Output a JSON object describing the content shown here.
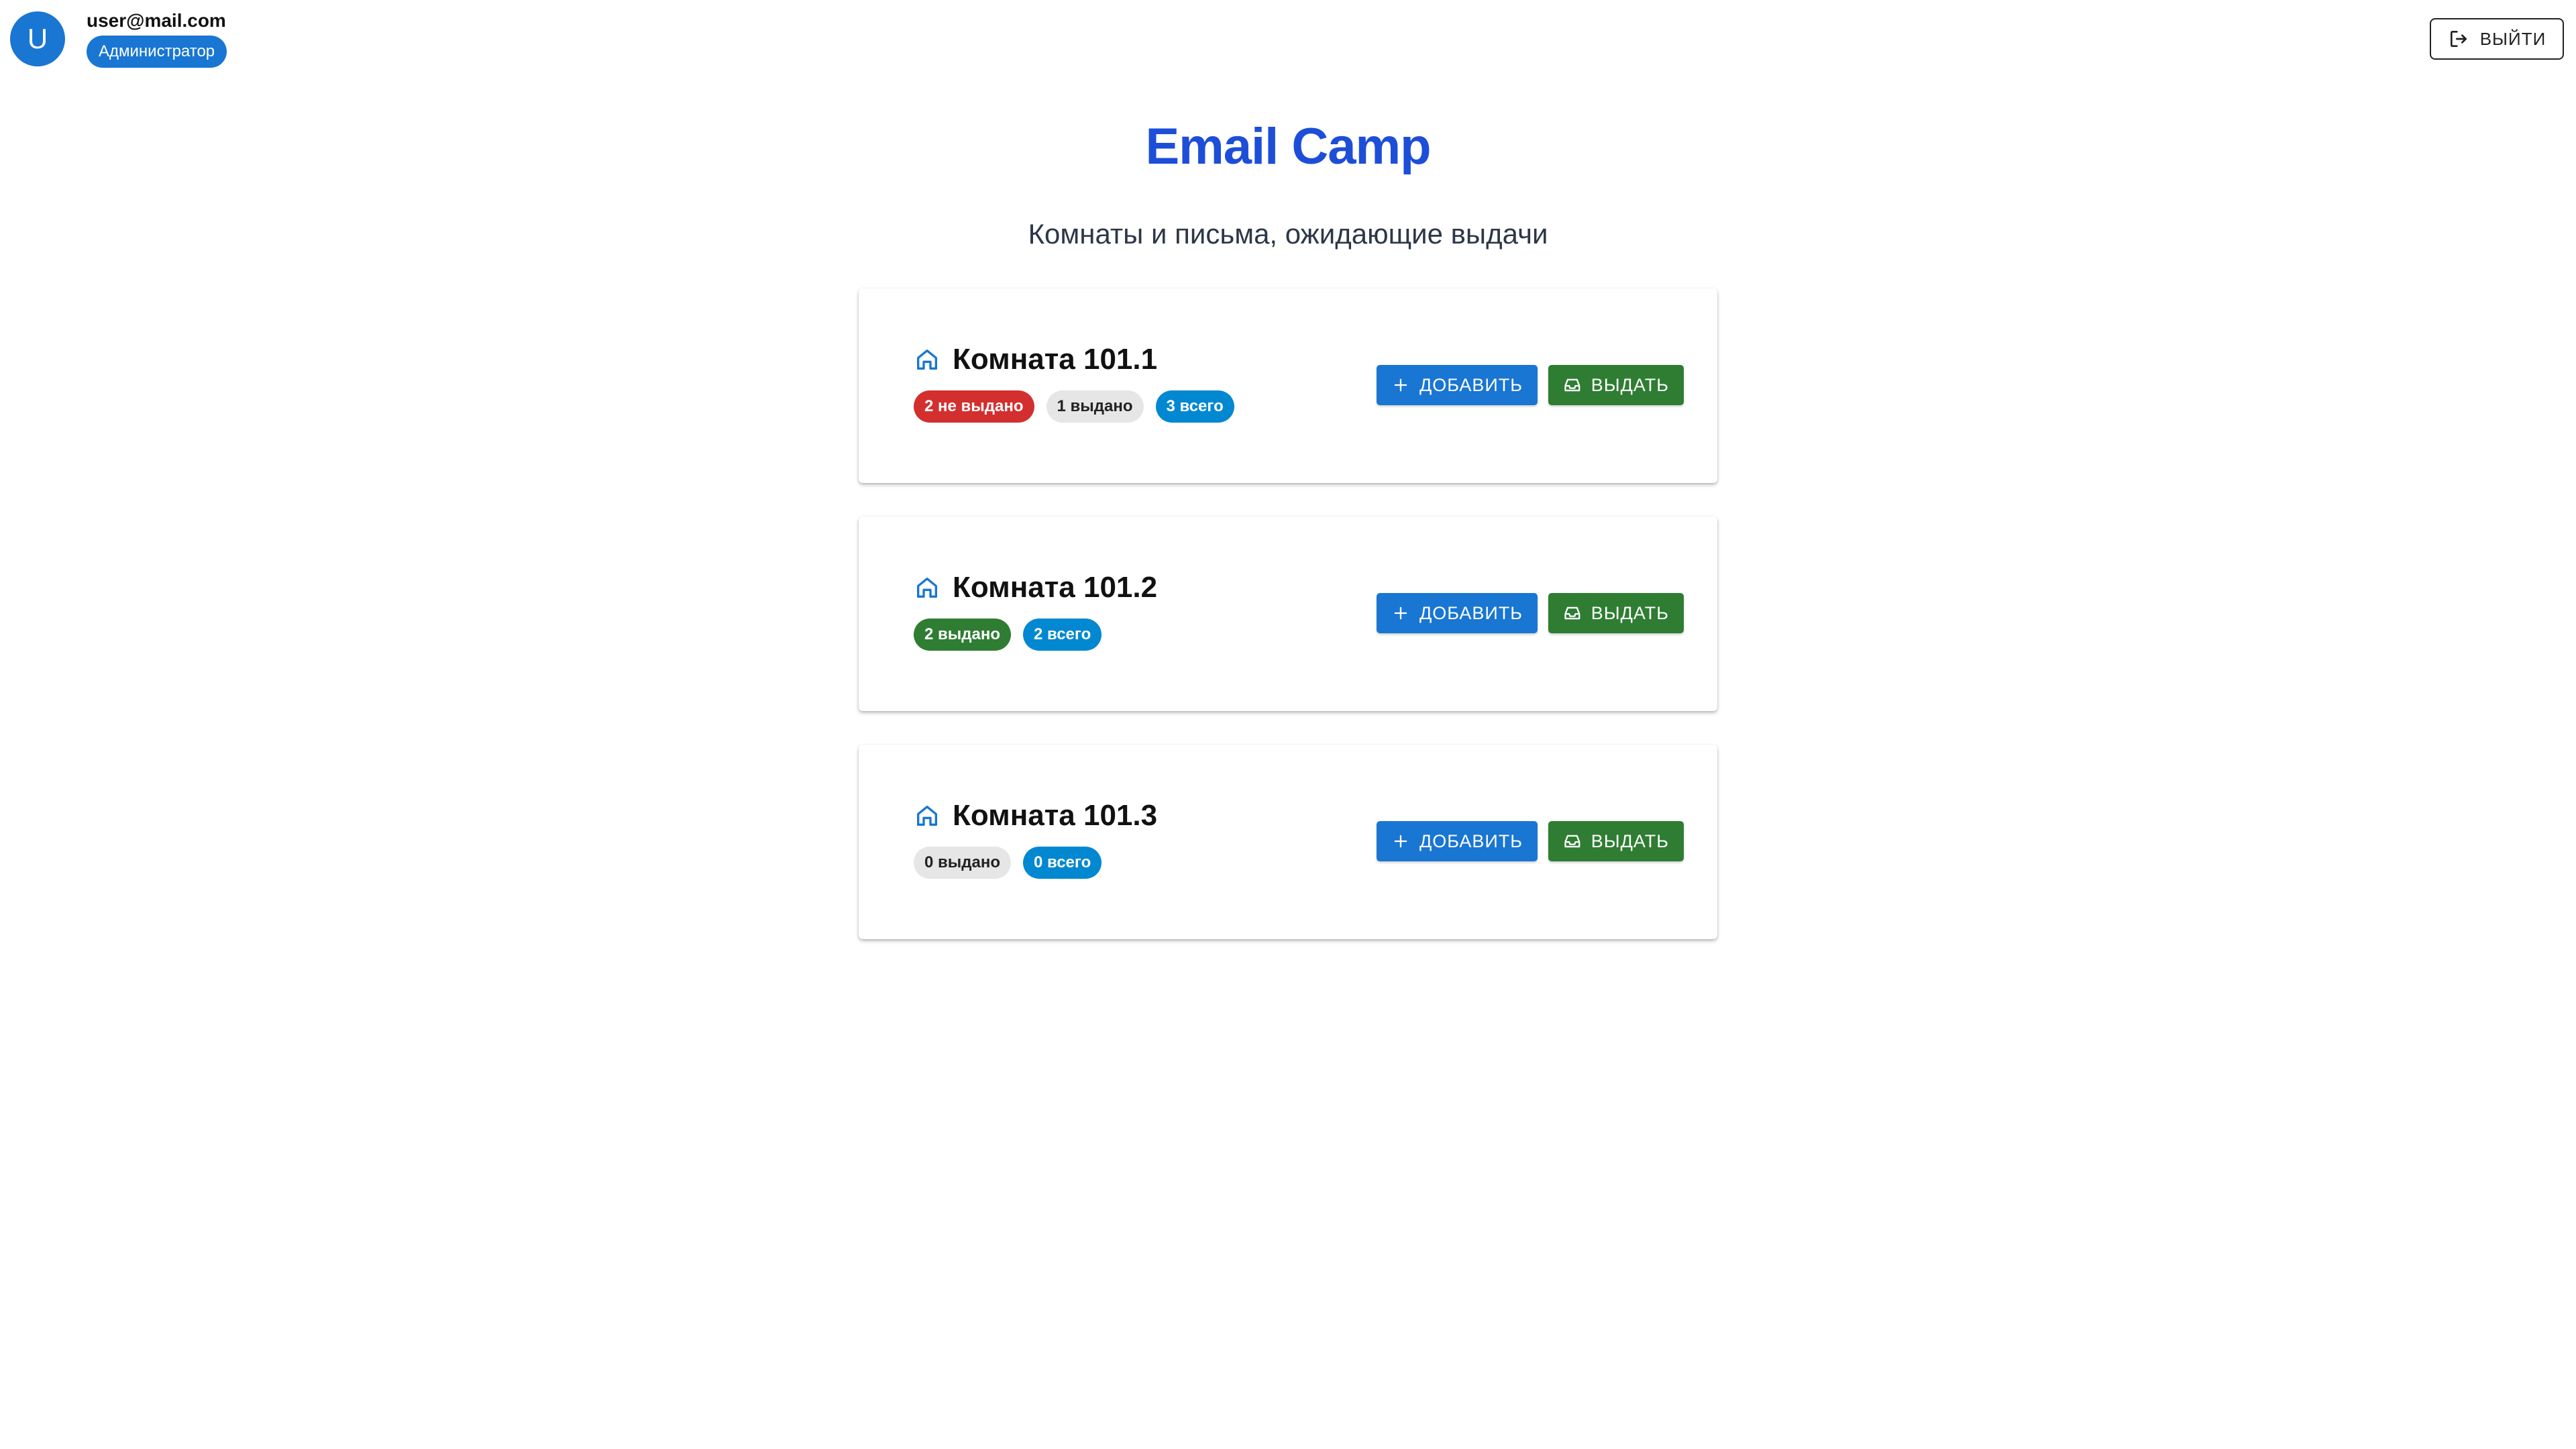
{
  "user": {
    "avatar_letter": "U",
    "email": "user@mail.com",
    "role": "Администратор"
  },
  "header": {
    "logout_label": "ВЫЙТИ"
  },
  "main": {
    "title": "Email Camp",
    "subtitle": "Комнаты и письма, ожидающие выдачи"
  },
  "rooms": [
    {
      "name": "Комната 101.1",
      "chips": [
        {
          "text": "2 не выдано",
          "color": "#d32f2f"
        },
        {
          "text": "1 выдано",
          "color": "#e6e6e6"
        },
        {
          "text": "3 всего",
          "color": "#0288d1"
        }
      ],
      "add_label": "ДОБАВИТЬ",
      "issue_label": "ВЫДАТЬ"
    },
    {
      "name": "Комната 101.2",
      "chips": [
        {
          "text": "2 выдано",
          "color": "#2e7d32"
        },
        {
          "text": "2 всего",
          "color": "#0288d1"
        }
      ],
      "add_label": "ДОБАВИТЬ",
      "issue_label": "ВЫДАТЬ"
    },
    {
      "name": "Комната 101.3",
      "chips": [
        {
          "text": "0 выдано",
          "color": "#e6e6e6"
        },
        {
          "text": "0 всего",
          "color": "#0288d1"
        }
      ],
      "add_label": "ДОБАВИТЬ",
      "issue_label": "ВЫДАТЬ"
    }
  ],
  "colors": {
    "primary": "#1976d2",
    "title": "#1d4ed8",
    "success": "#2e7d32",
    "error": "#d32f2f",
    "info": "#0288d1"
  }
}
